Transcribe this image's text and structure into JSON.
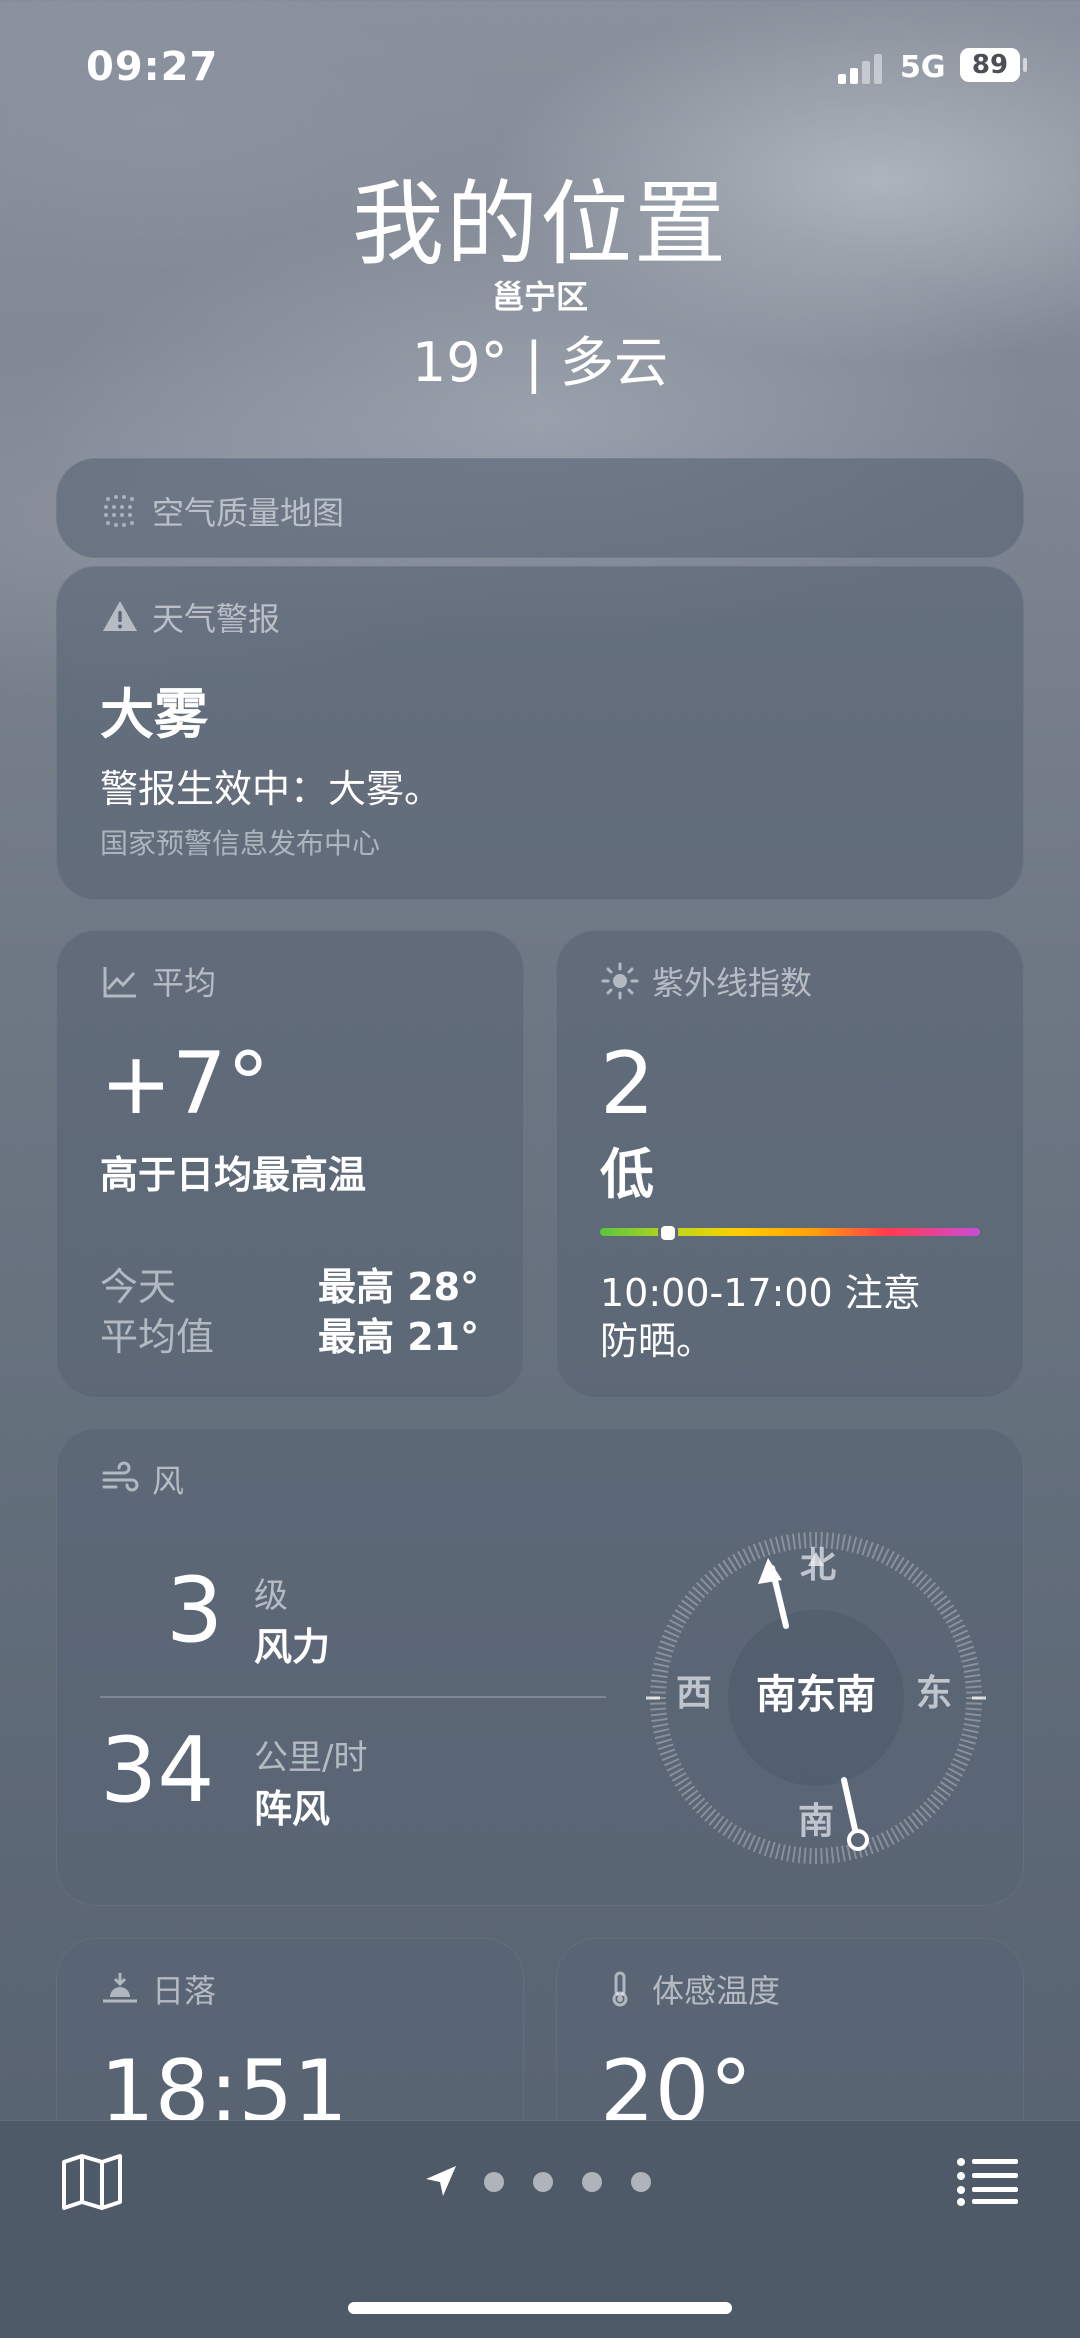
{
  "status_bar": {
    "time": "09:27",
    "network": "5G",
    "battery": "89"
  },
  "header": {
    "city": "我的位置",
    "district": "邕宁区",
    "temp_condition": "19° | 多云"
  },
  "air_quality": {
    "label": "空气质量地图"
  },
  "alert": {
    "label": "天气警报",
    "title": "大雾",
    "text": "警报生效中：大雾。",
    "source": "国家预警信息发布中心"
  },
  "average": {
    "label": "平均",
    "value": "+7°",
    "description": "高于日均最高温",
    "today_label": "今天",
    "today_value": "最高 28°",
    "avg_label": "平均值",
    "avg_value": "最高 21°"
  },
  "uv": {
    "label": "紫外线指数",
    "value": "2",
    "level": "低",
    "level_fraction": 0.18,
    "advice_line1": "10:00-17:00 注意",
    "advice_line2": "防晒。"
  },
  "wind": {
    "label": "风",
    "force_value": "3",
    "force_unit": "级",
    "force_label": "风力",
    "gust_value": "34",
    "gust_unit": "公里/时",
    "gust_label": "阵风",
    "direction": "南东南",
    "north": "北",
    "south": "南",
    "east": "东",
    "west": "西"
  },
  "sunset": {
    "label": "日落",
    "value": "18:51"
  },
  "feels_like": {
    "label": "体感温度",
    "value": "20°"
  },
  "colors": {
    "accent_uv_start": "#5ac43e",
    "accent_uv_end": "#c84ed8",
    "card_bg": "#58647a"
  }
}
